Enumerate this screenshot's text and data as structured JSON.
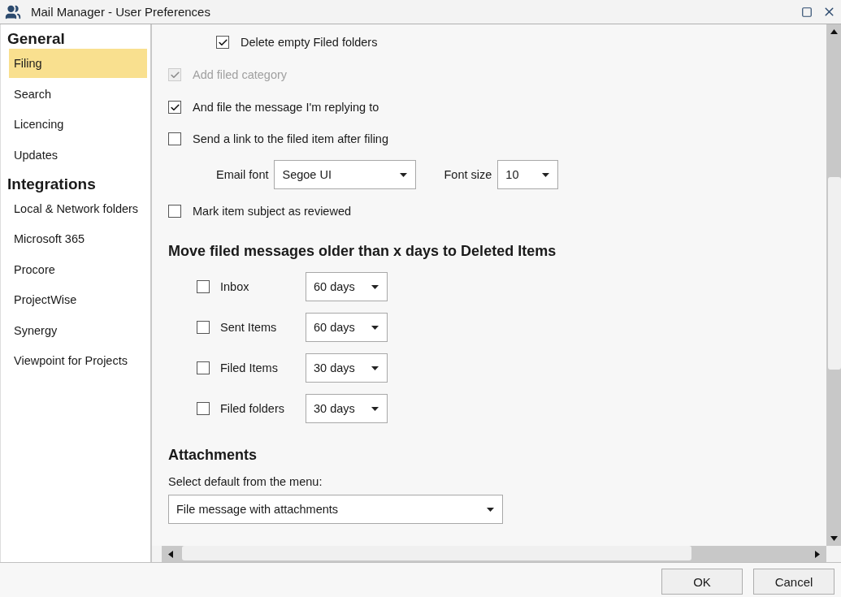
{
  "window": {
    "title": "Mail Manager - User Preferences"
  },
  "sidebar": {
    "sections": [
      {
        "heading": "General",
        "items": [
          {
            "label": "Filing",
            "selected": true
          },
          {
            "label": "Search",
            "selected": false
          },
          {
            "label": "Licencing",
            "selected": false
          },
          {
            "label": "Updates",
            "selected": false
          }
        ]
      },
      {
        "heading": "Integrations",
        "items": [
          {
            "label": "Local & Network folders",
            "selected": false
          },
          {
            "label": "Microsoft 365",
            "selected": false
          },
          {
            "label": "Procore",
            "selected": false
          },
          {
            "label": "ProjectWise",
            "selected": false
          },
          {
            "label": "Synergy",
            "selected": false
          },
          {
            "label": "Viewpoint for Projects",
            "selected": false
          }
        ]
      }
    ]
  },
  "options": [
    {
      "kind": "subcheckbox",
      "label": "Delete empty Filed folders",
      "checked": true,
      "disabled": false
    },
    {
      "kind": "checkbox",
      "label": "Add filed category",
      "checked": true,
      "disabled": true
    },
    {
      "kind": "checkbox",
      "label": "And file the message I'm replying to",
      "checked": true,
      "disabled": false
    },
    {
      "kind": "checkbox",
      "label": "Send a link to the filed item after filing",
      "checked": false,
      "disabled": false
    },
    {
      "kind": "fonts",
      "font_label": "Email font",
      "font_value": "Segoe UI",
      "size_label": "Font size",
      "size_value": "10"
    },
    {
      "kind": "checkbox",
      "label": "Mark item subject as reviewed",
      "checked": false,
      "disabled": false
    }
  ],
  "move_section": {
    "heading": "Move filed messages older than x days to Deleted Items",
    "rows": [
      {
        "label": "Inbox",
        "checked": false,
        "value": "60 days"
      },
      {
        "label": "Sent Items",
        "checked": false,
        "value": "60 days"
      },
      {
        "label": "Filed Items",
        "checked": false,
        "value": "30 days"
      },
      {
        "label": "Filed folders",
        "checked": false,
        "value": "30 days"
      }
    ]
  },
  "attachments": {
    "heading": "Attachments",
    "label": "Select default from the menu:",
    "value": "File message with attachments"
  },
  "buttons": [
    {
      "label": "OK"
    },
    {
      "label": "Cancel"
    }
  ]
}
